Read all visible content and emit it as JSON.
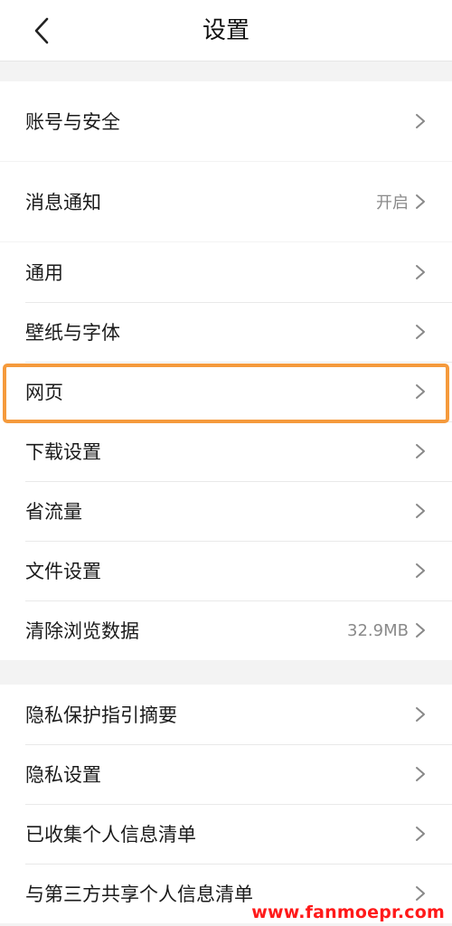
{
  "header": {
    "back_icon": "chevron-left-icon",
    "title": "设置"
  },
  "groups": [
    {
      "items": [
        {
          "label": "账号与安全",
          "value": ""
        }
      ]
    },
    {
      "items": [
        {
          "label": "消息通知",
          "value": "开启"
        }
      ]
    },
    {
      "items": [
        {
          "label": "通用",
          "value": ""
        },
        {
          "label": "壁纸与字体",
          "value": ""
        },
        {
          "label": "网页",
          "value": "",
          "highlighted": true
        },
        {
          "label": "下载设置",
          "value": ""
        },
        {
          "label": "省流量",
          "value": ""
        },
        {
          "label": "文件设置",
          "value": ""
        },
        {
          "label": "清除浏览数据",
          "value": "32.9MB"
        }
      ]
    },
    {
      "items": [
        {
          "label": "隐私保护指引摘要",
          "value": ""
        },
        {
          "label": "隐私设置",
          "value": ""
        },
        {
          "label": "已收集个人信息清单",
          "value": ""
        },
        {
          "label": "与第三方共享个人信息清单",
          "value": ""
        }
      ]
    }
  ],
  "row_chevron_icon": "chevron-right-icon",
  "highlight_color": "#f59a3c",
  "watermark": "www.fanmoepr.com"
}
